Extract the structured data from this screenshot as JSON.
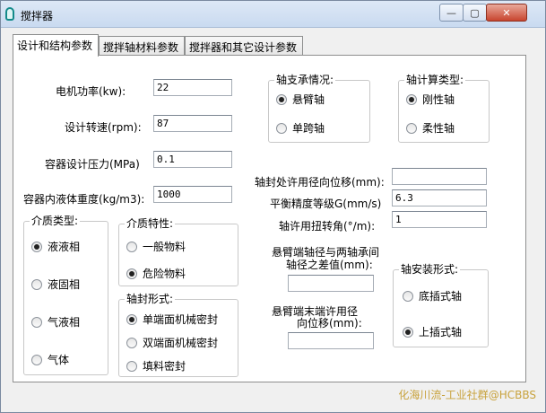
{
  "window": {
    "title": "搅拌器",
    "minimize": "—",
    "maximize": "▢",
    "close": "✕"
  },
  "tabs": [
    {
      "label": "设计和结构参数"
    },
    {
      "label": "搅拌轴材料参数"
    },
    {
      "label": "搅拌器和其它设计参数"
    }
  ],
  "fields": {
    "motor_power": {
      "label": "电机功率(kw):",
      "value": "22"
    },
    "design_speed": {
      "label": "设计转速(rpm):",
      "value": "87"
    },
    "design_pressure": {
      "label": "容器设计压力(MPa)",
      "value": "0.1"
    },
    "liquid_weight": {
      "label": "容器内液体重度(kg/m3):",
      "value": "1000"
    },
    "seal_radial_disp": {
      "label": "轴封处许用径向位移(mm):",
      "value": ""
    },
    "balance_grade": {
      "label": "平衡精度等级G(mm/s)",
      "value": "6.3"
    },
    "torsion_angle": {
      "label": "轴许用扭转角(°/m):",
      "value": "1"
    },
    "cantilever_diff": {
      "label_line1": "悬臂端轴径与两轴承间",
      "label_line2": "轴径之差值(mm):",
      "value": ""
    },
    "cantilever_disp": {
      "label_line1": "悬臂端末端许用径",
      "label_line2": "向位移(mm):",
      "value": ""
    }
  },
  "groups": {
    "shaft_support": {
      "title": "轴支承情况:",
      "options": [
        "悬臂轴",
        "单跨轴"
      ],
      "selected": 0
    },
    "shaft_calc": {
      "title": "轴计算类型:",
      "options": [
        "刚性轴",
        "柔性轴"
      ],
      "selected": 0
    },
    "medium_type": {
      "title": "介质类型:",
      "options": [
        "液液相",
        "液固相",
        "气液相",
        "气体"
      ],
      "selected": 0
    },
    "medium_property": {
      "title": "介质特性:",
      "options": [
        "一般物料",
        "危险物料"
      ],
      "selected": 1
    },
    "shaft_seal": {
      "title": "轴封形式:",
      "options": [
        "单端面机械密封",
        "双端面机械密封",
        "填料密封"
      ],
      "selected": 0
    },
    "mounting": {
      "title": "轴安装形式:",
      "options": [
        "底插式轴",
        "上插式轴"
      ],
      "selected": 1
    }
  },
  "watermark": "化海川流-工业社群@HCBBS"
}
